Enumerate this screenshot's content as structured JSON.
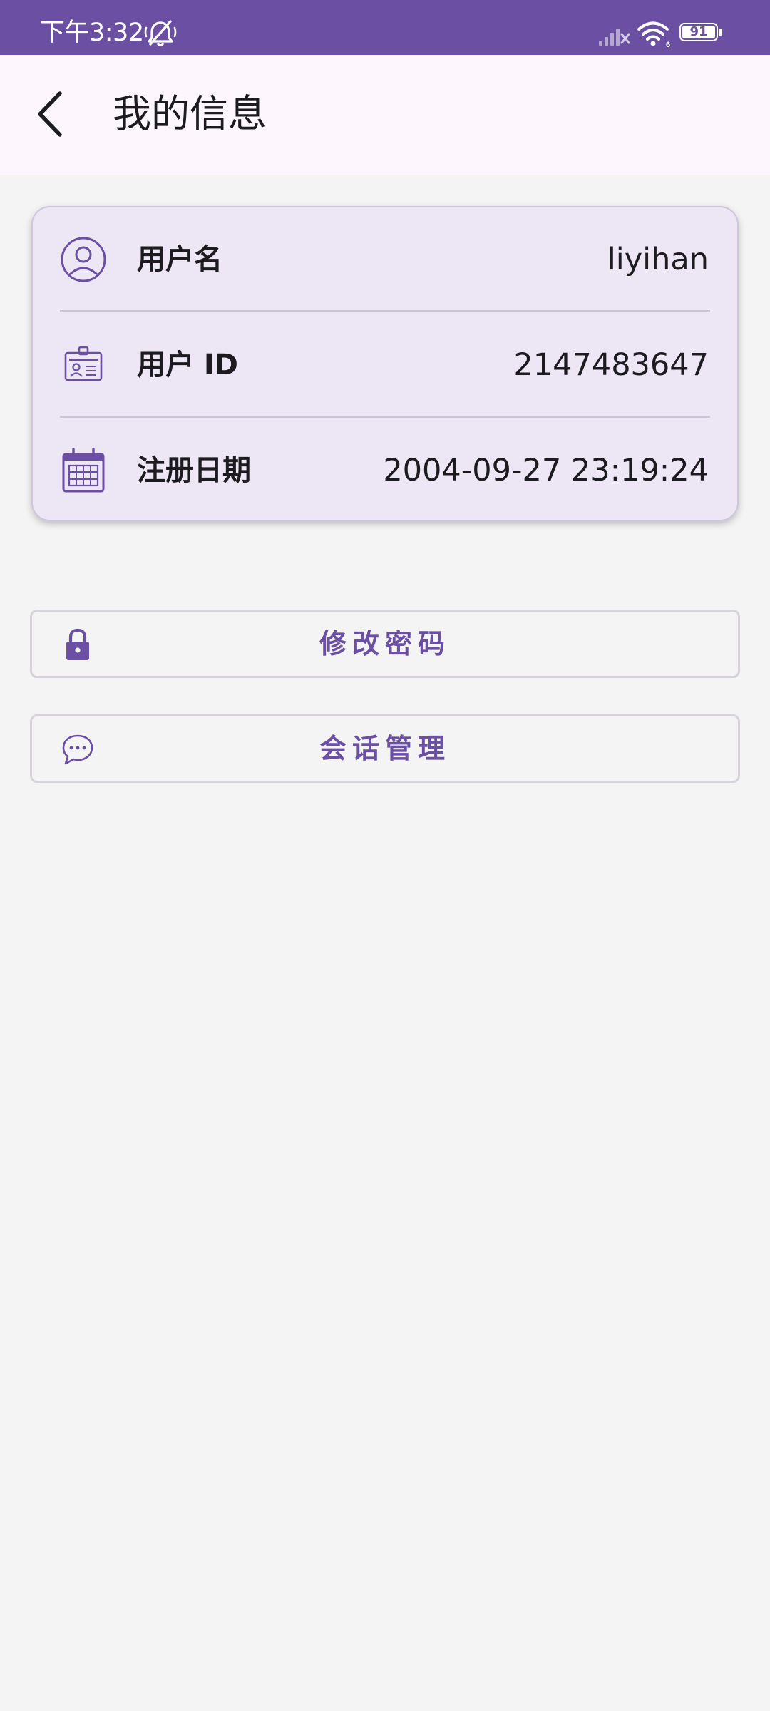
{
  "status_bar": {
    "time": "下午3:32",
    "battery_level": "91",
    "colors": {
      "background": "#6a4fa3",
      "foreground": "#ffffff"
    },
    "icons": [
      "bell-muted-icon",
      "signal-icon",
      "wifi-icon",
      "battery-icon"
    ]
  },
  "app_bar": {
    "title": "我的信息",
    "back_icon": "chevron-left-icon"
  },
  "info_card": {
    "rows": [
      {
        "icon": "user-circle-icon",
        "label": "用户名",
        "value": "liyihan"
      },
      {
        "icon": "id-badge-icon",
        "label": "用户 ID",
        "value": "2147483647"
      },
      {
        "icon": "calendar-icon",
        "label": "注册日期",
        "value": "2004-09-27 23:19:24"
      }
    ]
  },
  "actions": [
    {
      "icon": "lock-icon",
      "label": "修改密码"
    },
    {
      "icon": "chat-bubble-icon",
      "label": "会话管理"
    }
  ],
  "colors": {
    "accent": "#6a4fa3",
    "card_background": "#ede6f4",
    "page_background": "#f4f4f4",
    "app_bar_background": "#fdf7fd"
  }
}
